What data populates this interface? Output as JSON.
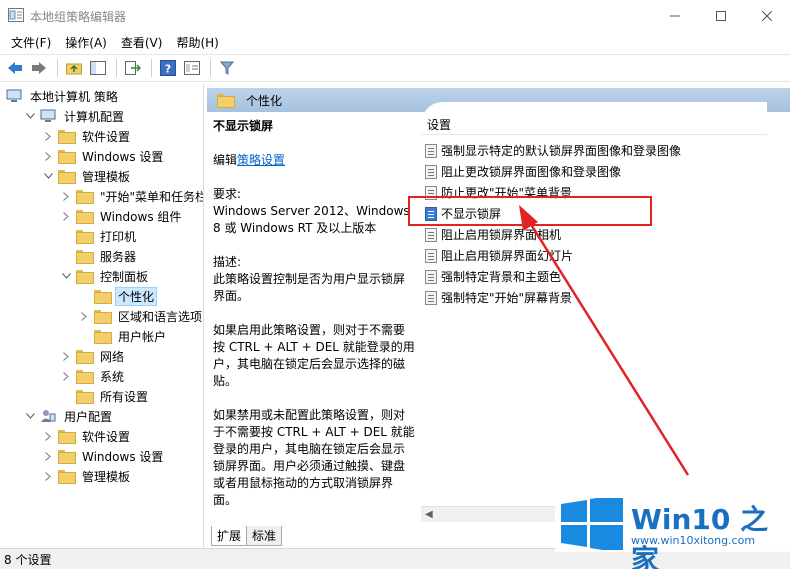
{
  "window": {
    "title": "本地组策略编辑器"
  },
  "menu": [
    "文件(F)",
    "操作(A)",
    "查看(V)",
    "帮助(H)"
  ],
  "tree": [
    {
      "label": "本地计算机 策略",
      "depth": 0,
      "chev": "",
      "icon": "computer"
    },
    {
      "label": "计算机配置",
      "depth": 1,
      "chev": "down",
      "icon": "computer"
    },
    {
      "label": "软件设置",
      "depth": 2,
      "chev": "right",
      "icon": "folder"
    },
    {
      "label": "Windows 设置",
      "depth": 2,
      "chev": "right",
      "icon": "folder"
    },
    {
      "label": "管理模板",
      "depth": 2,
      "chev": "down",
      "icon": "folder"
    },
    {
      "label": "\"开始\"菜单和任务栏",
      "depth": 3,
      "chev": "right",
      "icon": "folder"
    },
    {
      "label": "Windows 组件",
      "depth": 3,
      "chev": "right",
      "icon": "folder"
    },
    {
      "label": "打印机",
      "depth": 3,
      "chev": "",
      "icon": "folder"
    },
    {
      "label": "服务器",
      "depth": 3,
      "chev": "",
      "icon": "folder"
    },
    {
      "label": "控制面板",
      "depth": 3,
      "chev": "down",
      "icon": "folder"
    },
    {
      "label": "个性化",
      "depth": 4,
      "chev": "",
      "icon": "folder",
      "selected": true
    },
    {
      "label": "区域和语言选项",
      "depth": 4,
      "chev": "right",
      "icon": "folder"
    },
    {
      "label": "用户帐户",
      "depth": 4,
      "chev": "",
      "icon": "folder"
    },
    {
      "label": "网络",
      "depth": 3,
      "chev": "right",
      "icon": "folder"
    },
    {
      "label": "系统",
      "depth": 3,
      "chev": "right",
      "icon": "folder"
    },
    {
      "label": "所有设置",
      "depth": 3,
      "chev": "",
      "icon": "folder"
    },
    {
      "label": "用户配置",
      "depth": 1,
      "chev": "down",
      "icon": "user"
    },
    {
      "label": "软件设置",
      "depth": 2,
      "chev": "right",
      "icon": "folder"
    },
    {
      "label": "Windows 设置",
      "depth": 2,
      "chev": "right",
      "icon": "folder"
    },
    {
      "label": "管理模板",
      "depth": 2,
      "chev": "right",
      "icon": "folder"
    }
  ],
  "right": {
    "header_title": "个性化",
    "desc": {
      "title": "不显示锁屏",
      "edit_prefix": "编辑",
      "edit_link": "策略设置",
      "req_label": "要求:",
      "req_text": "Windows Server 2012、Windows 8 或 Windows RT 及以上版本",
      "desc_label": "描述:",
      "desc_text": "此策略设置控制是否为用户显示锁屏界面。",
      "enable_text": "如果启用此策略设置，则对于不需要按 CTRL + ALT + DEL 就能登录的用户，其电脑在锁定后会显示选择的磁贴。",
      "disable_text": "如果禁用或未配置此策略设置，则对于不需要按 CTRL + ALT + DEL 就能登录的用户，其电脑在锁定后会显示锁屏界面。用户必须通过触摸、键盘或者用鼠标拖动的方式取消锁屏界面。"
    },
    "list_header": "设置",
    "settings": [
      "强制显示特定的默认锁屏界面图像和登录图像",
      "阻止更改锁屏界面图像和登录图像",
      "防止更改\"开始\"菜单背景",
      "不显示锁屏",
      "阻止启用锁屏界面相机",
      "阻止启用锁屏界面幻灯片",
      "强制特定背景和主题色",
      "强制特定\"开始\"屏幕背景"
    ],
    "highlighted_index": 3,
    "tabs": [
      "扩展",
      "标准"
    ]
  },
  "status": "8 个设置",
  "watermark": {
    "title": "Win10 之家",
    "url": "www.win10xitong.com"
  },
  "colors": {
    "accent": "#1a6fc1",
    "annotation": "#e02424",
    "header": "#bcd3ea"
  }
}
